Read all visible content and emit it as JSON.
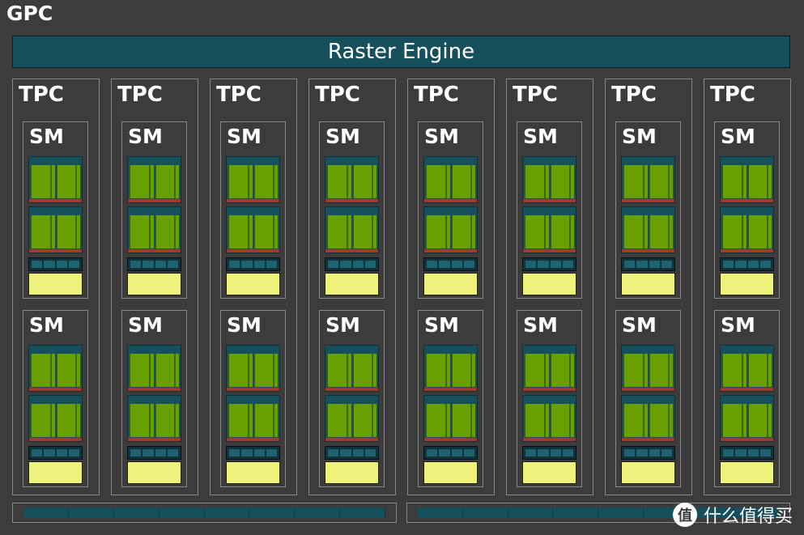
{
  "gpc": {
    "title": "GPC"
  },
  "raster_engine": {
    "label": "Raster Engine"
  },
  "tpc_label": "TPC",
  "sm_label": "SM",
  "watermark": {
    "icon_glyph": "值",
    "text": "什么值得买"
  },
  "colors": {
    "background": "#3c3c3c",
    "teal": "#17505d",
    "green": "#67a000",
    "red": "#9c3b2e",
    "yellow": "#eef27a",
    "border": "#8a8a8a"
  }
}
